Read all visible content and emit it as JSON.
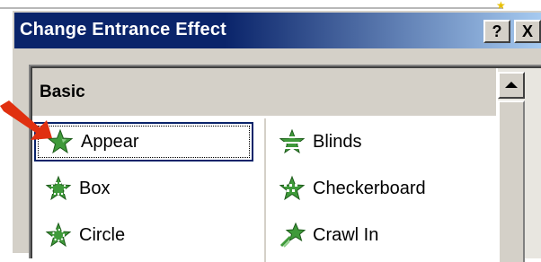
{
  "dialog": {
    "title": "Change Entrance Effect",
    "help_label": "?",
    "close_label": "X"
  },
  "group": {
    "title": "Basic"
  },
  "effects": [
    {
      "label": "Appear",
      "icon": "appear-star-icon",
      "selected": true
    },
    {
      "label": "Blinds",
      "icon": "blinds-star-icon",
      "selected": false
    },
    {
      "label": "Box",
      "icon": "box-star-icon",
      "selected": false
    },
    {
      "label": "Checkerboard",
      "icon": "checkerboard-star-icon",
      "selected": false
    },
    {
      "label": "Circle",
      "icon": "circle-star-icon",
      "selected": false
    },
    {
      "label": "Crawl In",
      "icon": "crawl-in-star-icon",
      "selected": false
    }
  ],
  "colors": {
    "title_bar": "#0a246a",
    "dialog_face": "#d4d0c8",
    "pointer_arrow": "#e03010",
    "star_fill": "#3f9a3a"
  }
}
